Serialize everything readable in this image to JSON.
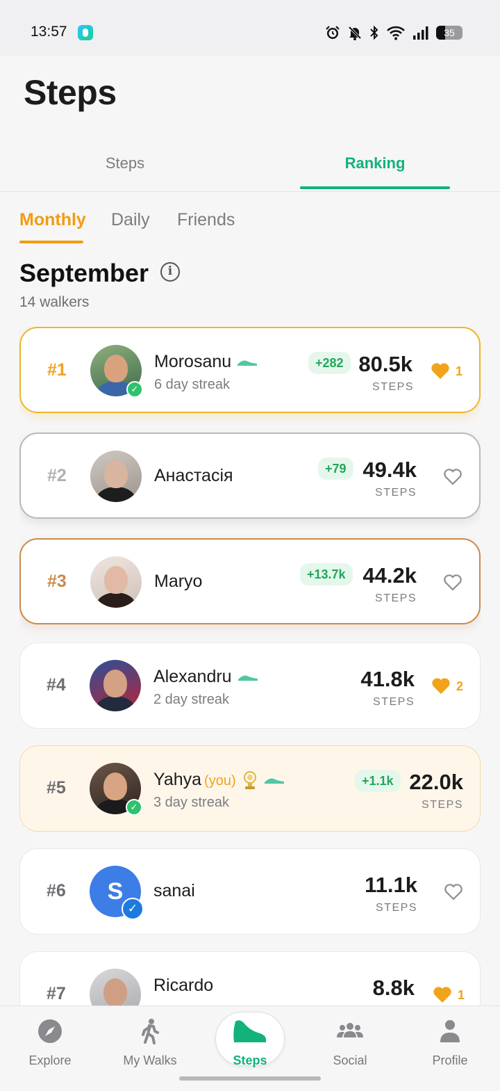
{
  "status_bar": {
    "time": "13:57",
    "battery_level": "35",
    "battery_fraction": 0.35,
    "icons": [
      "alarm-icon",
      "bell-off-icon",
      "bluetooth-icon",
      "wifi-icon",
      "signal-icon",
      "battery-icon"
    ]
  },
  "header": {
    "title": "Steps"
  },
  "main_tabs": [
    {
      "label": "Steps",
      "active": false
    },
    {
      "label": "Ranking",
      "active": true
    }
  ],
  "sub_tabs": [
    {
      "label": "Monthly",
      "active": true
    },
    {
      "label": "Daily",
      "active": false
    },
    {
      "label": "Friends",
      "active": false
    }
  ],
  "period": {
    "title": "September",
    "walkers": "14 walkers"
  },
  "ranking": [
    {
      "rank": "#1",
      "name": "Morosanu",
      "streak": "6 day streak",
      "gain": "+282",
      "steps": "80.5k",
      "steps_label": "STEPS",
      "liked": true,
      "likes": "1"
    },
    {
      "rank": "#2",
      "name": "Анастасія",
      "streak": "",
      "gain": "+79",
      "steps": "49.4k",
      "steps_label": "STEPS",
      "liked": false,
      "likes": ""
    },
    {
      "rank": "#3",
      "name": "Maryo",
      "streak": "",
      "gain": "+13.7k",
      "steps": "44.2k",
      "steps_label": "STEPS",
      "liked": false,
      "likes": ""
    },
    {
      "rank": "#4",
      "name": "Alexandru",
      "streak": "2 day streak",
      "gain": "",
      "steps": "41.8k",
      "steps_label": "STEPS",
      "liked": true,
      "likes": "2"
    },
    {
      "rank": "#5",
      "name": "Yahya",
      "you_tag": "(you)",
      "streak": "3 day streak",
      "gain": "+1.1k",
      "steps": "22.0k",
      "steps_label": "STEPS",
      "liked": false,
      "likes": ""
    },
    {
      "rank": "#6",
      "name": "sanai",
      "avatar_letter": "S",
      "streak": "",
      "gain": "",
      "steps": "11.1k",
      "steps_label": "STEPS",
      "liked": false,
      "likes": ""
    },
    {
      "rank": "#7",
      "name": "Ricardo",
      "streak": "",
      "gain": "",
      "steps": "8.8k",
      "steps_label": "STEPS",
      "liked": true,
      "likes": "1"
    }
  ],
  "bottom_nav": [
    {
      "label": "Explore",
      "icon": "compass-icon",
      "active": false
    },
    {
      "label": "My Walks",
      "icon": "walker-icon",
      "active": false
    },
    {
      "label": "Steps",
      "icon": "shoe-icon",
      "active": true
    },
    {
      "label": "Social",
      "icon": "people-icon",
      "active": false
    },
    {
      "label": "Profile",
      "icon": "person-icon",
      "active": false
    }
  ],
  "colors": {
    "accent_green": "#12b27a",
    "accent_orange": "#f0a31b",
    "gold": "#f0b429",
    "silver": "#b9b9bd",
    "bronze": "#c98a4b",
    "you_background": "#fff6ea"
  }
}
